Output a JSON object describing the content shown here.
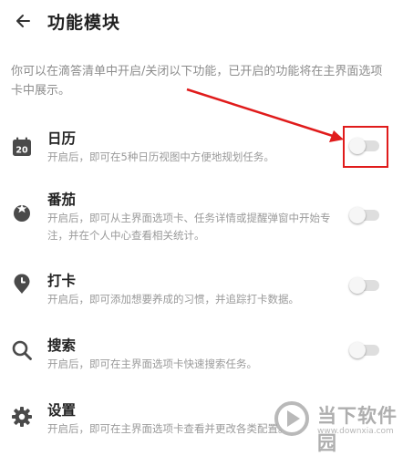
{
  "header": {
    "title": "功能模块"
  },
  "description": "你可以在滴答清单中开启/关闭以下功能，已开启的功能将在主界面选项卡中展示。",
  "features": [
    {
      "label": "日历",
      "subtitle": "开启后，即可在5种日历视图中方便地规划任务。",
      "icon": "calendar-icon",
      "icon_text": "20",
      "enabled": false
    },
    {
      "label": "番茄",
      "subtitle": "开启后，即可从主界面选项卡、任务详情或提醒弹窗中开始专注，并在个人中心查看相关统计。",
      "icon": "tomato-icon",
      "enabled": false
    },
    {
      "label": "打卡",
      "subtitle": "开启后，即可添加想要养成的习惯，并追踪打卡数据。",
      "icon": "habit-pin-icon",
      "enabled": false
    },
    {
      "label": "搜索",
      "subtitle": "开启后，即可在主界面选项卡快速搜索任务。",
      "icon": "search-icon",
      "enabled": false
    },
    {
      "label": "设置",
      "subtitle": "开启后，即可在主界面选项卡查看并更改各类配置。",
      "icon": "gear-icon",
      "enabled": false
    }
  ],
  "watermark": {
    "text": "当下软件园",
    "url": "www.downxia.com"
  },
  "colors": {
    "annotation": "#e01b1b",
    "toggle_track": "#dedede",
    "icon": "#4a4a4a",
    "secondary_text": "#9a9a9a"
  }
}
